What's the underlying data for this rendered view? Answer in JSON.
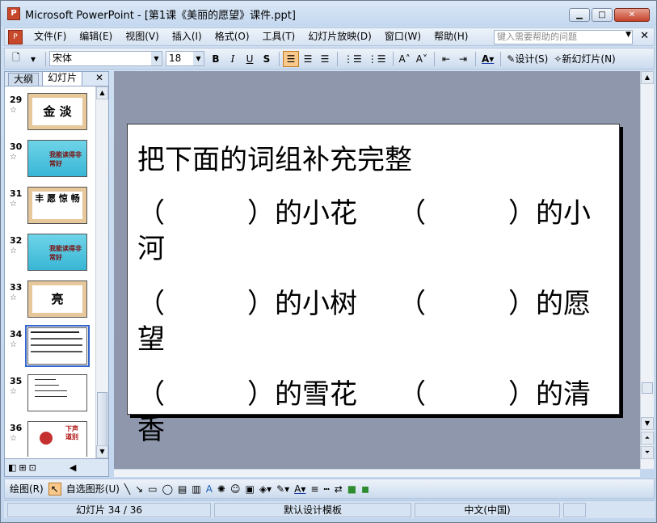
{
  "window": {
    "title": "Microsoft PowerPoint - [第1课《美丽的愿望》课件.ppt]",
    "app_icon": "P"
  },
  "menu": {
    "items": [
      "文件(F)",
      "编辑(E)",
      "视图(V)",
      "插入(I)",
      "格式(O)",
      "工具(T)",
      "幻灯片放映(D)",
      "窗口(W)",
      "帮助(H)"
    ],
    "help_placeholder": "键入需要帮助的问题"
  },
  "toolbar": {
    "font": "宋体",
    "size": "18",
    "design": "设计(S)",
    "new_slide": "新幻灯片(N)"
  },
  "panel": {
    "tab_outline": "大纲",
    "tab_slides": "幻灯片"
  },
  "thumbnails": [
    {
      "num": "29",
      "text": "金 淡"
    },
    {
      "num": "30",
      "text": "我能读得非常好"
    },
    {
      "num": "31",
      "text": "丰 愿 惊 畅"
    },
    {
      "num": "32",
      "text": "我能读得非常好"
    },
    {
      "num": "33",
      "text": "亮"
    },
    {
      "num": "34",
      "text": ""
    },
    {
      "num": "35",
      "text": ""
    },
    {
      "num": "36",
      "text": "下声道别"
    }
  ],
  "slide": {
    "lines": [
      "把下面的词组补充完整",
      "（　　　）的小花　　（　　　）的小",
      "河",
      "（　　　）的小树　　（　　　）的愿",
      "望",
      "（　　　）的雪花　　（　　　）的清",
      "香"
    ]
  },
  "drawing": {
    "draw": "绘图(R)",
    "autoshapes": "自选图形(U)"
  },
  "status": {
    "slide": "幻灯片 34 / 36",
    "template": "默认设计模板",
    "language": "中文(中国)"
  }
}
